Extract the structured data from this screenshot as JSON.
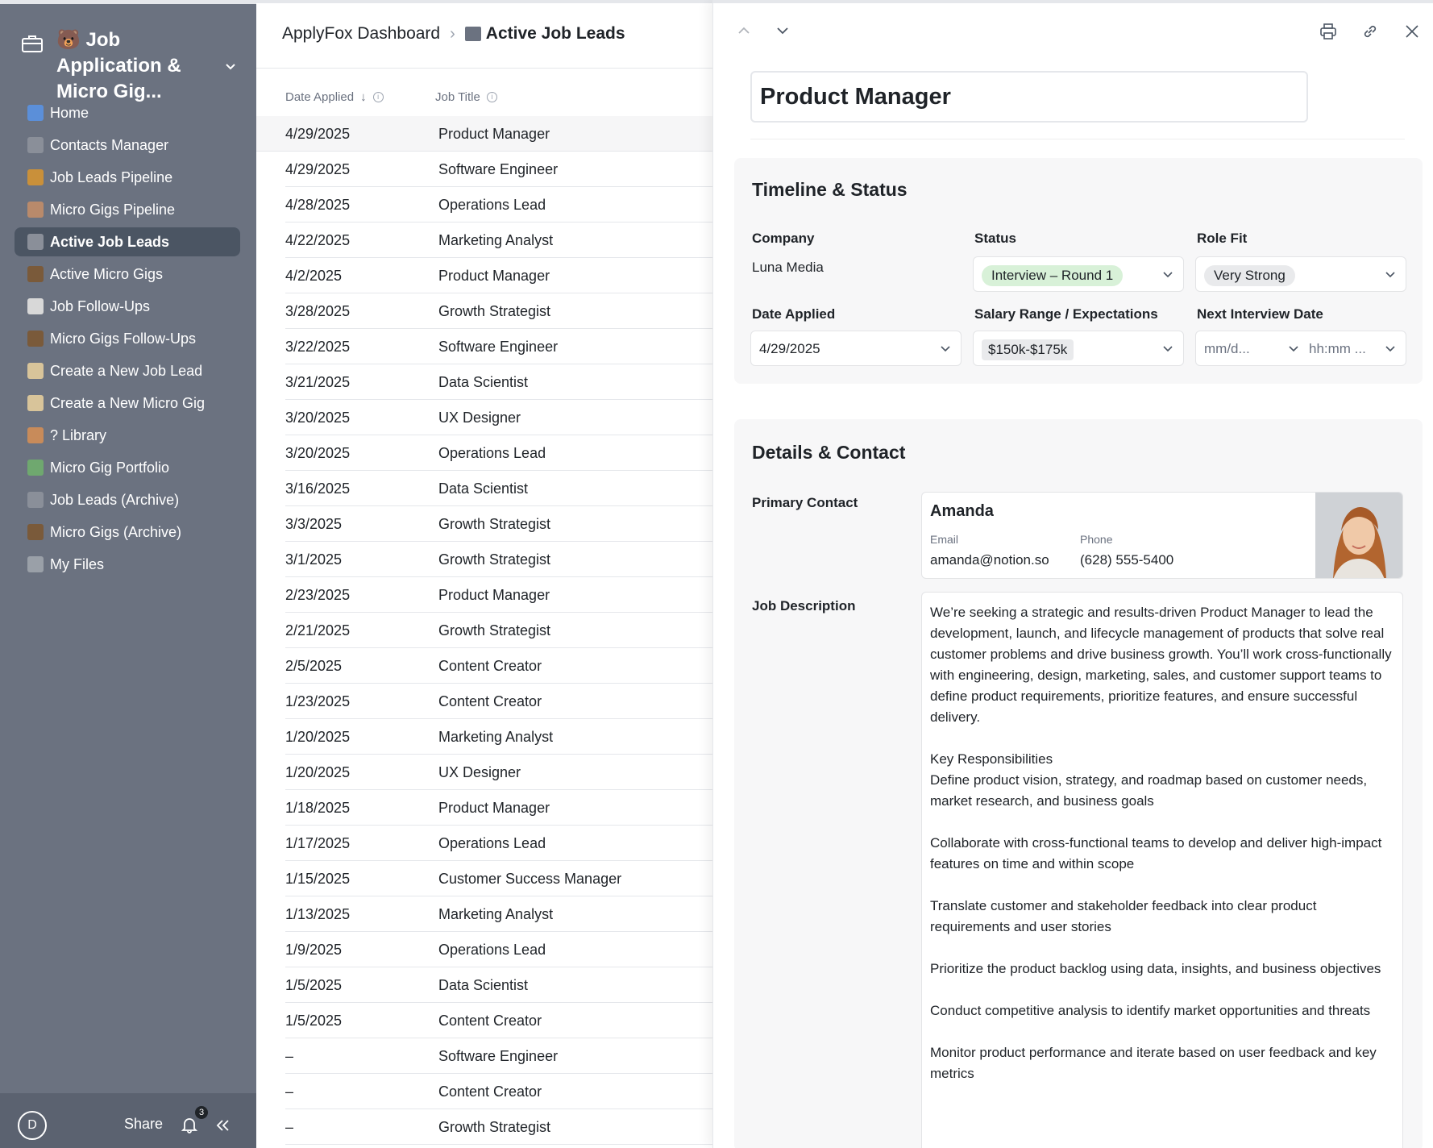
{
  "sidebar": {
    "workspace_title": "🐻 Job Application & Micro Gig...",
    "items": [
      {
        "label": "Home",
        "color": "#5b8fd9"
      },
      {
        "label": "Contacts Manager",
        "color": "#8a8f99"
      },
      {
        "label": "Job Leads Pipeline",
        "color": "#c9903a"
      },
      {
        "label": "Micro Gigs Pipeline",
        "color": "#b98a6b"
      },
      {
        "label": "Active Job Leads",
        "color": "#8a8f99"
      },
      {
        "label": "Active Micro Gigs",
        "color": "#7a5a3a"
      },
      {
        "label": "Job Follow-Ups",
        "color": "#d8d8d8"
      },
      {
        "label": "Micro Gigs Follow-Ups",
        "color": "#7a5a3a"
      },
      {
        "label": "Create a New Job Lead",
        "color": "#d8c49a"
      },
      {
        "label": "Create a New Micro Gig",
        "color": "#d8c49a"
      },
      {
        "label": "? Library",
        "color": "#c88b5a"
      },
      {
        "label": "Micro Gig Portfolio",
        "color": "#6fa86f"
      },
      {
        "label": "Job Leads (Archive)",
        "color": "#8a8f99"
      },
      {
        "label": "Micro Gigs (Archive)",
        "color": "#7a5a3a"
      },
      {
        "label": "My Files",
        "color": "#9aa0a8"
      }
    ],
    "active_index": 4,
    "footer": {
      "avatar_letter": "D",
      "share_label": "Share",
      "notification_count": "3"
    }
  },
  "breadcrumb": {
    "root": "ApplyFox Dashboard",
    "current": "Active Job Leads"
  },
  "table": {
    "columns": [
      "Date Applied",
      "Job Title"
    ],
    "rows": [
      [
        "4/29/2025",
        "Product Manager"
      ],
      [
        "4/29/2025",
        "Software Engineer"
      ],
      [
        "4/28/2025",
        "Operations Lead"
      ],
      [
        "4/22/2025",
        "Marketing Analyst"
      ],
      [
        "4/2/2025",
        "Product Manager"
      ],
      [
        "3/28/2025",
        "Growth Strategist"
      ],
      [
        "3/22/2025",
        "Software Engineer"
      ],
      [
        "3/21/2025",
        "Data Scientist"
      ],
      [
        "3/20/2025",
        "UX Designer"
      ],
      [
        "3/20/2025",
        "Operations Lead"
      ],
      [
        "3/16/2025",
        "Data Scientist"
      ],
      [
        "3/3/2025",
        "Growth Strategist"
      ],
      [
        "3/1/2025",
        "Growth Strategist"
      ],
      [
        "2/23/2025",
        "Product Manager"
      ],
      [
        "2/21/2025",
        "Growth Strategist"
      ],
      [
        "2/5/2025",
        "Content Creator"
      ],
      [
        "1/23/2025",
        "Content Creator"
      ],
      [
        "1/20/2025",
        "Marketing Analyst"
      ],
      [
        "1/20/2025",
        "UX Designer"
      ],
      [
        "1/18/2025",
        "Product Manager"
      ],
      [
        "1/17/2025",
        "Operations Lead"
      ],
      [
        "1/15/2025",
        "Customer Success Manager"
      ],
      [
        "1/13/2025",
        "Marketing Analyst"
      ],
      [
        "1/9/2025",
        "Operations Lead"
      ],
      [
        "1/5/2025",
        "Data Scientist"
      ],
      [
        "1/5/2025",
        "Content Creator"
      ],
      [
        "–",
        "Software Engineer"
      ],
      [
        "–",
        "Content Creator"
      ],
      [
        "–",
        "Growth Strategist"
      ]
    ]
  },
  "detail": {
    "title": "Product Manager",
    "timeline": {
      "heading": "Timeline & Status",
      "company_label": "Company",
      "company_value": "Luna Media",
      "status_label": "Status",
      "status_value": "Interview – Round 1",
      "rolefit_label": "Role Fit",
      "rolefit_value": "Very Strong",
      "date_label": "Date Applied",
      "date_value": "4/29/2025",
      "salary_label": "Salary Range / Expectations",
      "salary_value": "$150k-$175k",
      "interview_label": "Next Interview Date",
      "interview_date_placeholder": "mm/d...",
      "interview_time_placeholder": "hh:mm ..."
    },
    "details": {
      "heading": "Details & Contact",
      "contact_label": "Primary Contact",
      "contact_name": "Amanda",
      "email_label": "Email",
      "email_value": "amanda@notion.so",
      "phone_label": "Phone",
      "phone_value": "(628) 555-5400",
      "description_label": "Job Description",
      "description": [
        "We’re seeking a strategic and results-driven Product Manager to lead the development, launch, and lifecycle management of products that solve real customer problems and drive business growth. You’ll work cross-functionally with engineering, design, marketing, sales, and customer support teams to define product requirements, prioritize features, and ensure successful delivery.",
        "Key Responsibilities\nDefine product vision, strategy, and roadmap based on customer needs, market research, and business goals",
        "Collaborate with cross-functional teams to develop and deliver high-impact features on time and within scope",
        "Translate customer and stakeholder feedback into clear product requirements and user stories",
        "Prioritize the product backlog using data, insights, and business objectives",
        "Conduct competitive analysis to identify market opportunities and threats",
        "Monitor product performance and iterate based on user feedback and key metrics"
      ]
    }
  }
}
